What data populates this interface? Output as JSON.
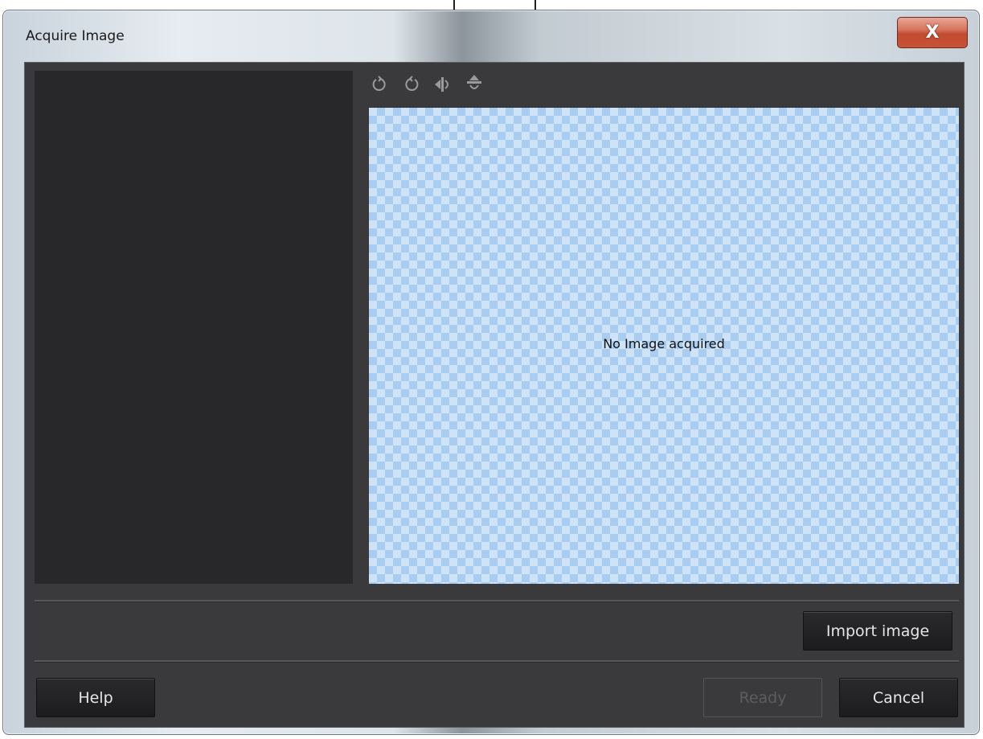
{
  "window": {
    "title": "Acquire Image",
    "close_glyph": "X"
  },
  "toolbar": {
    "icons": [
      "rotate-left-icon",
      "rotate-right-icon",
      "flip-horizontal-icon",
      "flip-vertical-icon"
    ]
  },
  "preview": {
    "empty_text": "No Image acquired"
  },
  "buttons": {
    "import": "Import image",
    "help": "Help",
    "ready": "Ready",
    "cancel": "Cancel"
  },
  "colors": {
    "client_bg": "#3a3a3c",
    "panel_bg": "#28282a",
    "checker_light": "#cfe3f6",
    "checker_dark": "#a9cdf0",
    "close_red": "#c24a2f"
  }
}
